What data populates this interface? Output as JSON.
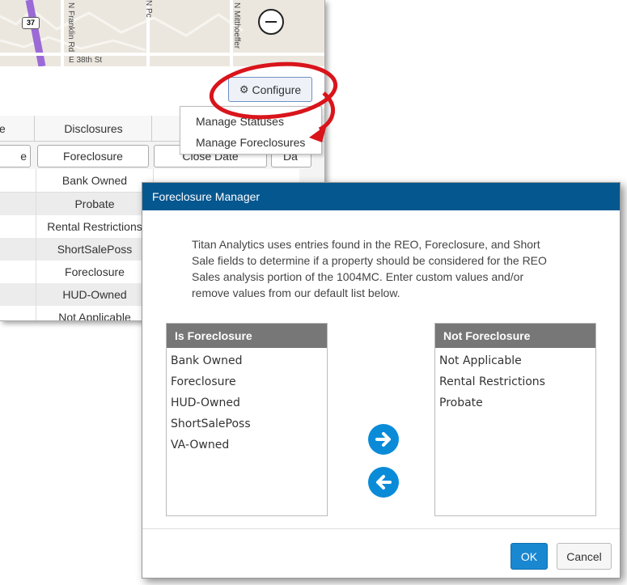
{
  "background": {
    "map": {
      "shield_label": "37",
      "road_labels": [
        "N Franklin Rd",
        "N Pc",
        "N Mitthoeffer",
        "E 38th St"
      ]
    },
    "configure_label": "Configure",
    "columns": [
      "e",
      "Disclosures",
      "",
      ""
    ],
    "filters": [
      "e",
      "Foreclosure",
      "Close Date",
      "Da"
    ],
    "rows": [
      "Bank Owned",
      "Probate",
      "Rental Restrictions",
      "ShortSalePoss",
      "Foreclosure",
      "HUD-Owned",
      "Not Applicable"
    ],
    "dropdown": [
      "Manage Statuses",
      "Manage Foreclosures"
    ]
  },
  "modal": {
    "title": "Foreclosure Manager",
    "intro": "Titan Analytics uses entries found in the REO, Foreclosure, and Short Sale fields to determine if a property should be considered for the REO Sales analysis portion of the 1004MC. Enter custom values and/or remove values from our default list below.",
    "is_foreclosure": {
      "header": "Is Foreclosure",
      "items": [
        "Bank Owned",
        "Foreclosure",
        "HUD-Owned",
        "ShortSalePoss",
        "VA-Owned"
      ]
    },
    "not_foreclosure": {
      "header": "Not Foreclosure",
      "items": [
        "Not Applicable",
        "Rental Restrictions",
        "Probate"
      ]
    },
    "ok_label": "OK",
    "cancel_label": "Cancel"
  },
  "colors": {
    "modal_header": "#05578f",
    "primary_button": "#1a87d1",
    "arrow_button": "#0a8bd8",
    "annotation": "#d9141b"
  },
  "icons": [
    "gear-icon",
    "zoom-out-icon",
    "arrow-right-icon",
    "arrow-left-icon"
  ]
}
